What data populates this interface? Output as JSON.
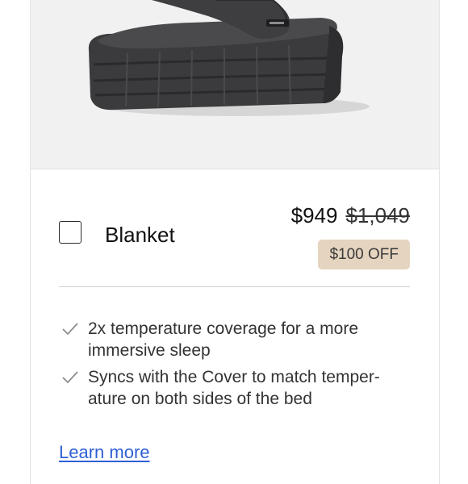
{
  "product": {
    "name": "Blanket",
    "price": "$949",
    "original_price": "$1,049",
    "discount_badge": "$100 OFF",
    "features": [
      "2x temperature coverage for a more immersive sleep",
      "Syncs with the Cover to match temper-ature on both sides of the bed"
    ],
    "learn_more_label": "Learn more"
  },
  "colors": {
    "badge_background": "#e5d4bf",
    "link": "#2f5fd6",
    "image_background": "#f1f1f1"
  },
  "icons": {
    "checkbox": "checkbox-unchecked",
    "feature_bullet": "checkmark-icon"
  }
}
